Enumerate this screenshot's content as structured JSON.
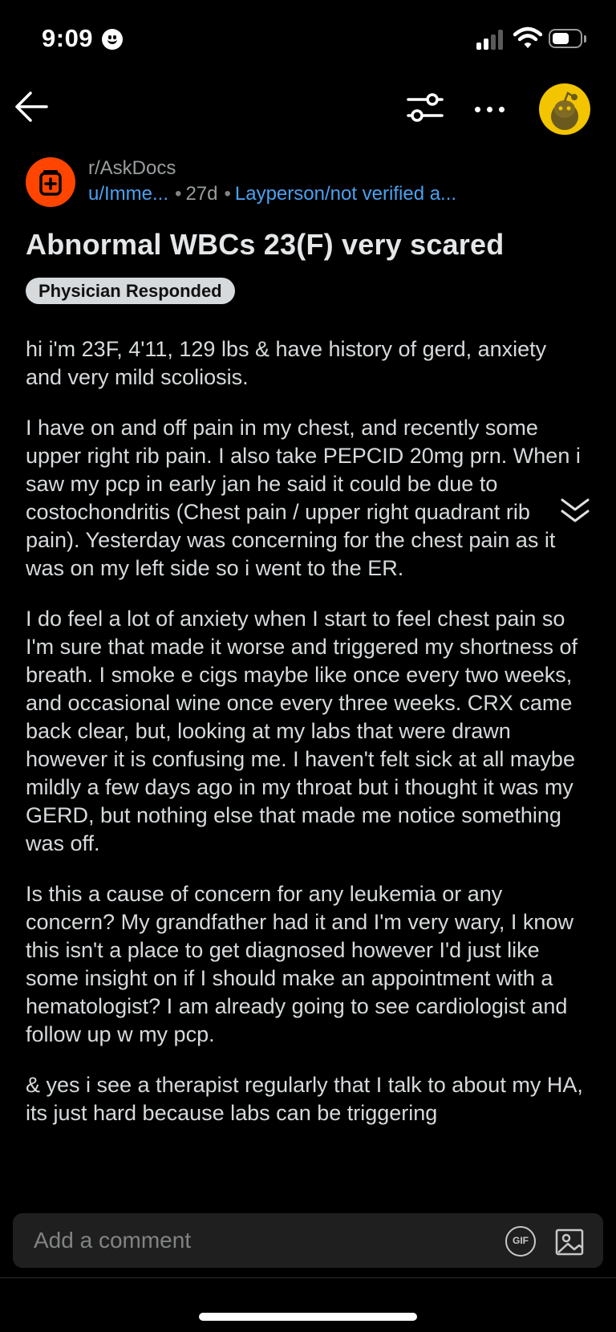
{
  "status_bar": {
    "time": "9:09"
  },
  "post": {
    "subreddit": "r/AskDocs",
    "author": "u/Imme...",
    "age": "27d",
    "flair": "Layperson/not verified a...",
    "title": "Abnormal WBCs 23(F) very scared",
    "badge": "Physician Responded",
    "paragraphs": [
      "hi i'm 23F, 4'11, 129 lbs & have history of gerd, anxiety and very mild scoliosis.",
      "I have on and off pain in my chest, and recently some upper right rib pain. I also take PEPCID 20mg prn. When i saw my pcp in early jan he said it could be due to costochondritis (Chest pain / upper right quadrant rib pain). Yesterday was concerning for the chest pain as it was on my left side so i went to the ER.",
      "I do feel a lot of anxiety when I start to feel chest pain so I'm sure that made it worse and triggered my shortness of breath. I smoke e cigs maybe like once every two weeks, and occasional wine once every three weeks.  CRX came back clear, but, looking at my labs that were drawn however it is confusing me. I haven't felt sick at all maybe mildly a few days ago in my throat but i thought it was my GERD, but nothing else that made me notice something was off.",
      "Is this a cause of concern for any leukemia or any concern? My grandfather had it and I'm very wary, I know this isn't a place to get diagnosed however I'd just like some insight on if I should make an appointment with a hematologist? I am already going to see cardiologist and follow up w my pcp.",
      "& yes i see a therapist regularly that I talk to about my HA, its just hard because labs can be triggering"
    ]
  },
  "comment_bar": {
    "placeholder": "Add a comment",
    "gif_label": "GIF"
  },
  "colors": {
    "background": "#000000",
    "link": "#4ba1f0",
    "subreddit_icon": "#ff4500",
    "avatar": "#f2c500",
    "text": "#d7dadc"
  },
  "icons": [
    "back-arrow-icon",
    "filter-icon",
    "more-icon",
    "avatar-icon",
    "subreddit-icon",
    "expand-icon",
    "gif-icon",
    "image-icon"
  ]
}
